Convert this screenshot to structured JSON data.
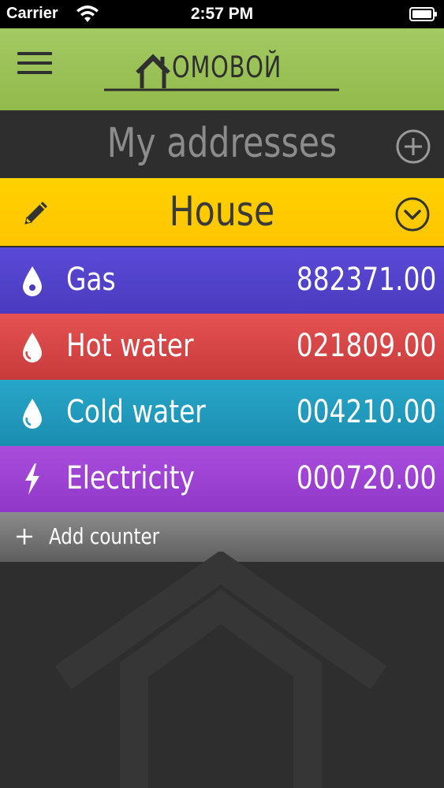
{
  "status_bar": {
    "carrier": "Carrier",
    "time": "2:57 PM"
  },
  "header": {
    "logo_text": "ОМОВОЙ",
    "logo_icon": "house-outline-icon",
    "menu_icon": "hamburger-menu-icon",
    "color": "#9bc256"
  },
  "addresses": {
    "title": "My addresses",
    "add_icon": "plus-circle-icon"
  },
  "address": {
    "name": "House",
    "edit_icon": "pencil-icon",
    "expand_icon": "chevron-down-circle-icon",
    "color": "#ffc800"
  },
  "counters": [
    {
      "name": "Gas",
      "value": "882371.00",
      "icon": "drop-icon",
      "color": "#5040cc"
    },
    {
      "name": "Hot water",
      "value": "021809.00",
      "icon": "drop-icon",
      "color": "#d84545"
    },
    {
      "name": "Cold water",
      "value": "004210.00",
      "icon": "drop-icon",
      "color": "#229bbd"
    },
    {
      "name": "Electricity",
      "value": "000720.00",
      "icon": "lightning-icon",
      "color": "#9e43d2"
    }
  ],
  "add_counter": {
    "label": "Add counter",
    "icon": "plus-icon"
  }
}
